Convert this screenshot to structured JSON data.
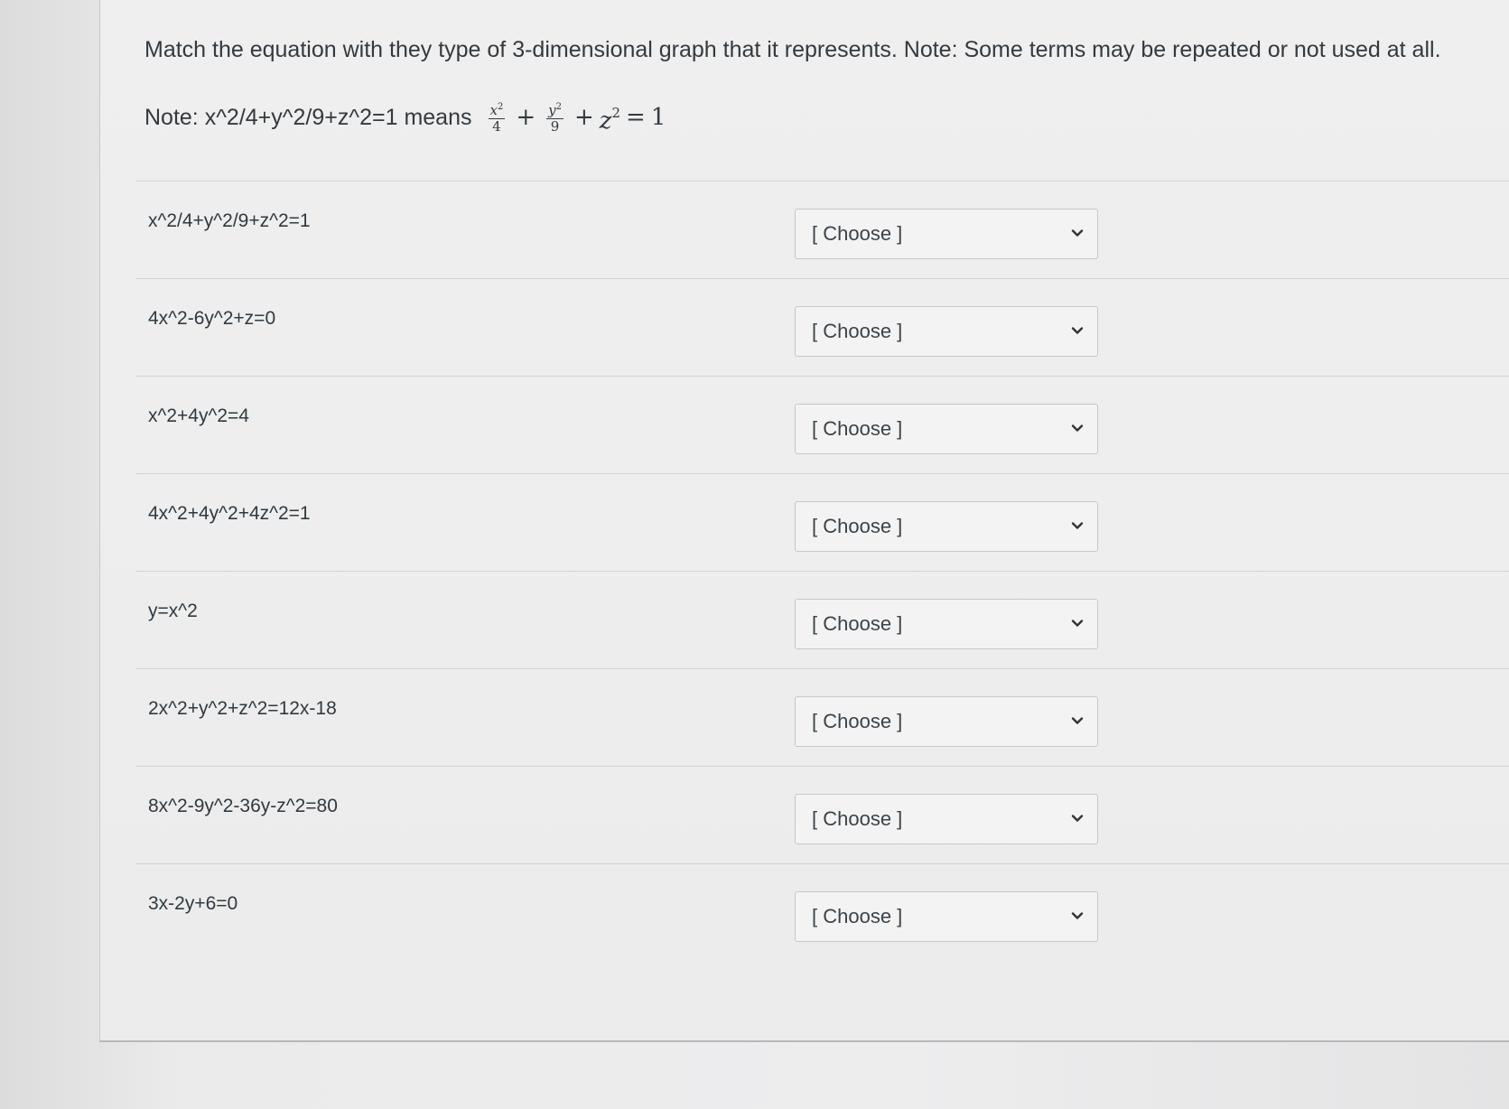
{
  "question": {
    "instruction": "Match the equation with they type of 3-dimensional graph that it represents. Note: Some terms may be repeated or not used at all.",
    "note_prefix": "Note: x^2/4+y^2/9+z^2=1 means",
    "note_math": {
      "frac1_num": "x",
      "frac1_num_exp": "2",
      "frac1_den": "4",
      "frac2_num": "y",
      "frac2_num_exp": "2",
      "frac2_den": "9",
      "plus": "+",
      "z_term": "z",
      "z_exp": "2",
      "equals": "=",
      "rhs": "1"
    }
  },
  "rows": [
    {
      "equation": "x^2/4+y^2/9+z^2=1",
      "select_value": "[ Choose ]"
    },
    {
      "equation": "4x^2-6y^2+z=0",
      "select_value": "[ Choose ]"
    },
    {
      "equation": "x^2+4y^2=4",
      "select_value": "[ Choose ]"
    },
    {
      "equation": "4x^2+4y^2+4z^2=1",
      "select_value": "[ Choose ]"
    },
    {
      "equation": "y=x^2",
      "select_value": "[ Choose ]"
    },
    {
      "equation": "2x^2+y^2+z^2=12x-18",
      "select_value": "[ Choose ]"
    },
    {
      "equation": "8x^2-9y^2-36y-z^2=80",
      "select_value": "[ Choose ]"
    },
    {
      "equation": "3x-2y+6=0",
      "select_value": "[ Choose ]"
    }
  ],
  "icons": {
    "dropdown": "chevron-down-icon"
  }
}
